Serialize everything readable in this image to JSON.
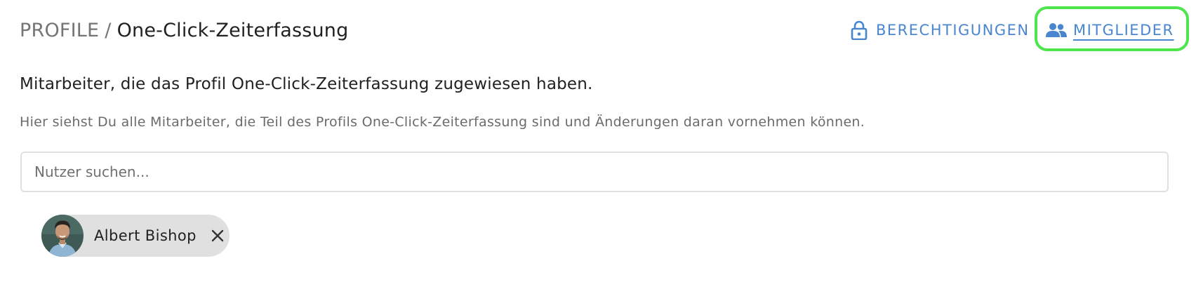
{
  "header": {
    "breadcrumb": {
      "root": "PROFILE",
      "separator": "/",
      "current": "One-Click-Zeiterfassung"
    },
    "tabs": {
      "permissions": {
        "label": "BERECHTIGUNGEN",
        "icon": "lock-icon"
      },
      "members": {
        "label": "MITGLIEDER",
        "icon": "people-icon",
        "active": true
      }
    }
  },
  "main": {
    "heading": "Mitarbeiter, die das Profil One-Click-Zeiterfassung zugewiesen haben.",
    "description": "Hier siehst Du alle Mitarbeiter, die Teil des Profils One-Click-Zeiterfassung sind und Änderungen daran vornehmen können.",
    "search": {
      "placeholder": "Nutzer suchen...",
      "value": ""
    },
    "members": [
      {
        "name": "Albert Bishop",
        "avatar": "avatar-photo",
        "remove_icon": "close-icon"
      }
    ]
  },
  "colors": {
    "accent": "#4a86cf",
    "highlight": "#4ee44e",
    "chip_background": "#e0e0e0",
    "text_primary": "#212121",
    "text_secondary": "#757575"
  }
}
